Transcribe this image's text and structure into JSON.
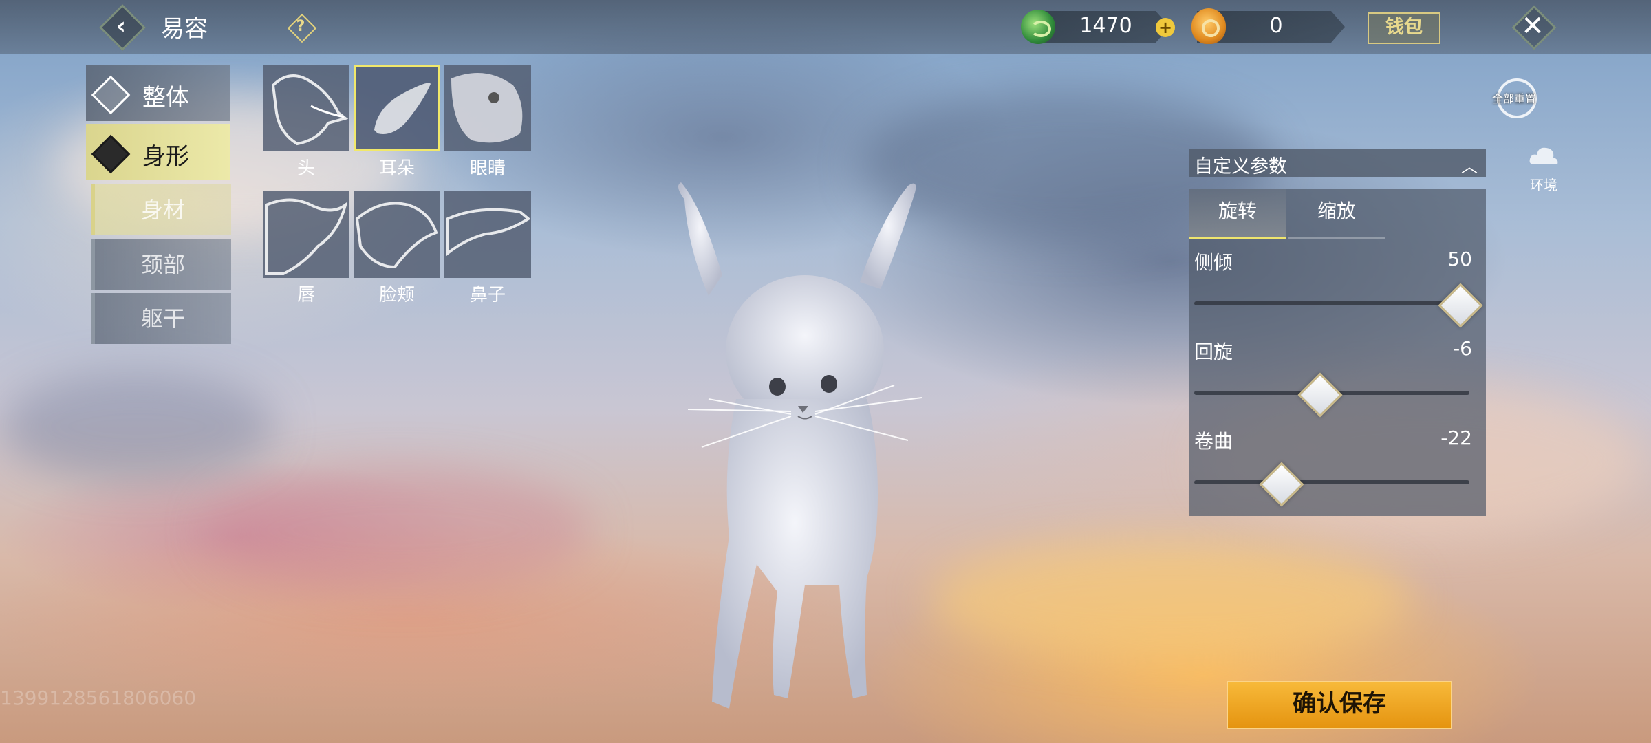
{
  "header": {
    "title": "易容",
    "help_icon": "question-diamond-icon",
    "currency_jade": "1470",
    "currency_coin": "0",
    "wallet_label": "钱包"
  },
  "categories": [
    {
      "label": "整体",
      "icon": "diamond-white-icon",
      "active": false
    },
    {
      "label": "身形",
      "icon": "diamond-black-icon",
      "active": true
    }
  ],
  "sub_categories": [
    {
      "label": "身材",
      "active": true
    },
    {
      "label": "颈部",
      "active": false
    },
    {
      "label": "躯干",
      "active": false
    }
  ],
  "parts": [
    {
      "label": "头",
      "selected": false
    },
    {
      "label": "耳朵",
      "selected": true
    },
    {
      "label": "眼睛",
      "selected": false
    },
    {
      "label": "唇",
      "selected": false
    },
    {
      "label": "脸颊",
      "selected": false
    },
    {
      "label": "鼻子",
      "selected": false
    }
  ],
  "right": {
    "reset_label": "全部重置",
    "env_label": "环境",
    "custom_title": "自定义参数",
    "tabs": [
      {
        "label": "旋转",
        "active": true
      },
      {
        "label": "缩放",
        "active": false
      }
    ],
    "sliders": [
      {
        "label": "侧倾",
        "value": "50",
        "fraction": 0.96
      },
      {
        "label": "回旋",
        "value": "-6",
        "fraction": 0.45
      },
      {
        "label": "卷曲",
        "value": "-22",
        "fraction": 0.31
      }
    ]
  },
  "confirm_label": "确认保存",
  "watermark": "1399128561806060",
  "colors": {
    "accent": "#efe56e",
    "confirm": "#f0a824"
  }
}
